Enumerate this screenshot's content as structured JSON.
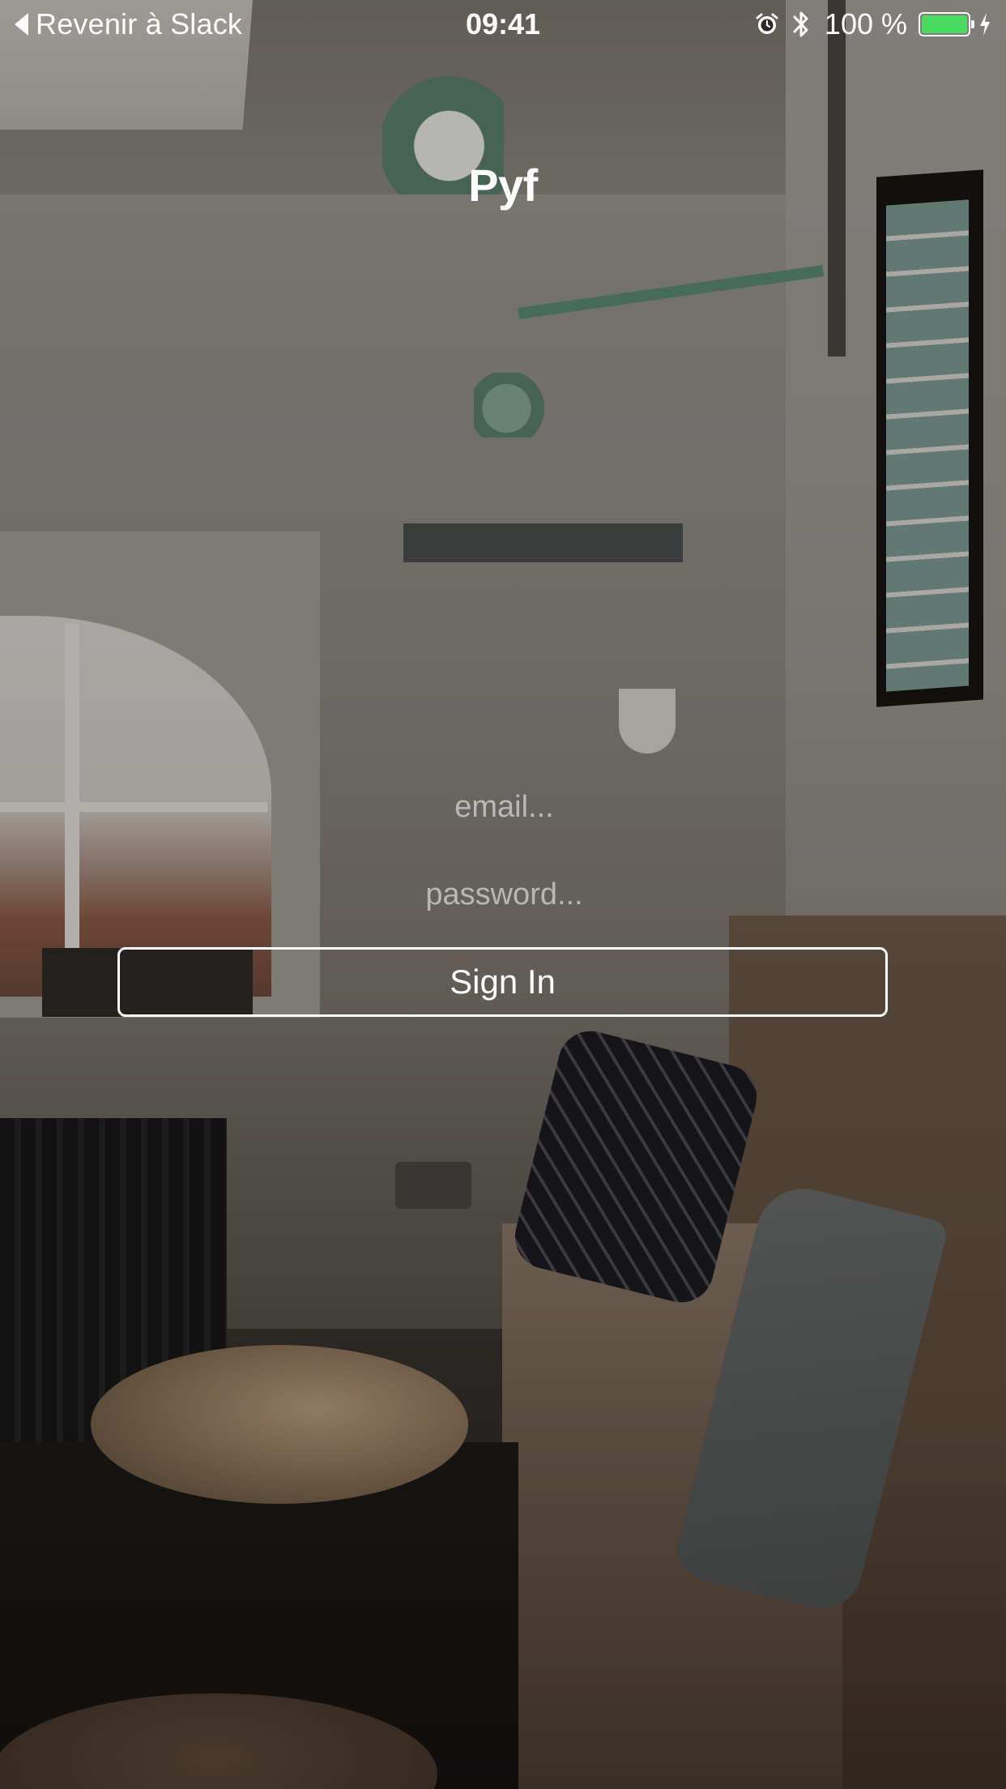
{
  "status_bar": {
    "back_label": "Revenir à Slack",
    "time": "09:41",
    "battery_percent_label": "100 %",
    "battery_level": 1.0,
    "battery_color": "#4cd964",
    "icons": [
      "chevron-left-icon",
      "alarm-icon",
      "bluetooth-icon",
      "battery-icon",
      "charging-bolt-icon"
    ]
  },
  "app": {
    "title": "Pyf"
  },
  "login_form": {
    "email_placeholder": "email...",
    "email_value": "",
    "password_placeholder": "password...",
    "password_value": "",
    "sign_in_label": "Sign In"
  }
}
